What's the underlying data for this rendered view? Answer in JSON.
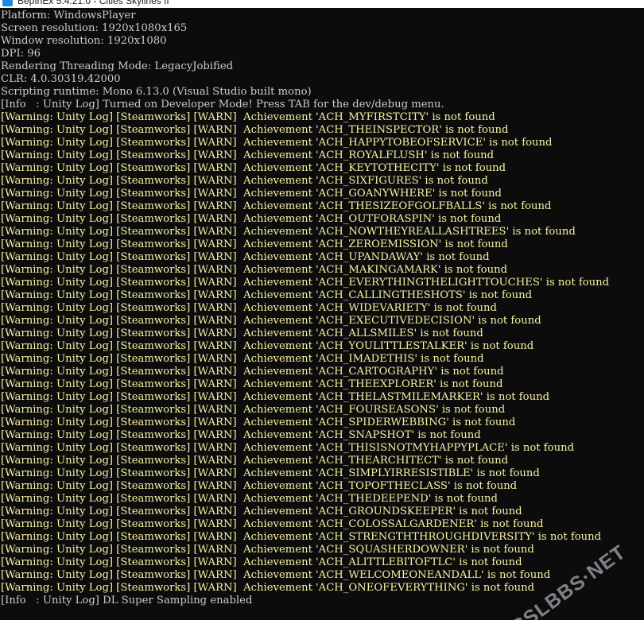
{
  "window": {
    "title": "BepInEx 5.4.21.0 - Cities Skylines II"
  },
  "header_lines": [
    "Platform: WindowsPlayer",
    "Screen resolution: 1920x1080x165",
    "Window resolution: 1920x1080",
    "DPI: 96",
    "Rendering Threading Mode: LegacyJobified",
    "CLR: 4.0.30319.42000",
    "Scripting runtime: Mono 6.13.0 (Visual Studio built mono)"
  ],
  "info_dev_mode": "[Info   : Unity Log] Turned on Developer Mode! Press TAB for the dev/debug menu.",
  "warning_lines": [
    "[Warning: Unity Log] [Steamworks] [WARN]  Achievement 'ACH_MYFIRSTCITY' is not found",
    "[Warning: Unity Log] [Steamworks] [WARN]  Achievement 'ACH_THEINSPECTOR' is not found",
    "[Warning: Unity Log] [Steamworks] [WARN]  Achievement 'ACH_HAPPYTOBEOFSERVICE' is not found",
    "[Warning: Unity Log] [Steamworks] [WARN]  Achievement 'ACH_ROYALFLUSH' is not found",
    "[Warning: Unity Log] [Steamworks] [WARN]  Achievement 'ACH_KEYTOTHECITY' is not found",
    "[Warning: Unity Log] [Steamworks] [WARN]  Achievement 'ACH_SIXFIGURES' is not found",
    "[Warning: Unity Log] [Steamworks] [WARN]  Achievement 'ACH_GOANYWHERE' is not found",
    "[Warning: Unity Log] [Steamworks] [WARN]  Achievement 'ACH_THESIZEOFGOLFBALLS' is not found",
    "[Warning: Unity Log] [Steamworks] [WARN]  Achievement 'ACH_OUTFORASPIN' is not found",
    "[Warning: Unity Log] [Steamworks] [WARN]  Achievement 'ACH_NOWTHEYREALLASHTREES' is not found",
    "[Warning: Unity Log] [Steamworks] [WARN]  Achievement 'ACH_ZEROEMISSION' is not found",
    "[Warning: Unity Log] [Steamworks] [WARN]  Achievement 'ACH_UPANDAWAY' is not found",
    "[Warning: Unity Log] [Steamworks] [WARN]  Achievement 'ACH_MAKINGAMARK' is not found",
    "[Warning: Unity Log] [Steamworks] [WARN]  Achievement 'ACH_EVERYTHINGTHELIGHTTOUCHES' is not found",
    "[Warning: Unity Log] [Steamworks] [WARN]  Achievement 'ACH_CALLINGTHESHOTS' is not found",
    "[Warning: Unity Log] [Steamworks] [WARN]  Achievement 'ACH_WIDEVARIETY' is not found",
    "[Warning: Unity Log] [Steamworks] [WARN]  Achievement 'ACH_EXECUTIVEDECISION' is not found",
    "[Warning: Unity Log] [Steamworks] [WARN]  Achievement 'ACH_ALLSMILES' is not found",
    "[Warning: Unity Log] [Steamworks] [WARN]  Achievement 'ACH_YOULITTLESTALKER' is not found",
    "[Warning: Unity Log] [Steamworks] [WARN]  Achievement 'ACH_IMADETHIS' is not found",
    "[Warning: Unity Log] [Steamworks] [WARN]  Achievement 'ACH_CARTOGRAPHY' is not found",
    "[Warning: Unity Log] [Steamworks] [WARN]  Achievement 'ACH_THEEXPLORER' is not found",
    "[Warning: Unity Log] [Steamworks] [WARN]  Achievement 'ACH_THELASTMILEMARKER' is not found",
    "[Warning: Unity Log] [Steamworks] [WARN]  Achievement 'ACH_FOURSEASONS' is not found",
    "[Warning: Unity Log] [Steamworks] [WARN]  Achievement 'ACH_SPIDERWEBBING' is not found",
    "[Warning: Unity Log] [Steamworks] [WARN]  Achievement 'ACH_SNAPSHOT' is not found",
    "[Warning: Unity Log] [Steamworks] [WARN]  Achievement 'ACH_THISISNOTMYHAPPYPLACE' is not found",
    "[Warning: Unity Log] [Steamworks] [WARN]  Achievement 'ACH_THEARCHITECT' is not found",
    "[Warning: Unity Log] [Steamworks] [WARN]  Achievement 'ACH_SIMPLYIRRESISTIBLE' is not found",
    "[Warning: Unity Log] [Steamworks] [WARN]  Achievement 'ACH_TOPOFTHECLASS' is not found",
    "[Warning: Unity Log] [Steamworks] [WARN]  Achievement 'ACH_THEDEEPEND' is not found",
    "[Warning: Unity Log] [Steamworks] [WARN]  Achievement 'ACH_GROUNDSKEEPER' is not found",
    "[Warning: Unity Log] [Steamworks] [WARN]  Achievement 'ACH_COLOSSALGARDENER' is not found",
    "[Warning: Unity Log] [Steamworks] [WARN]  Achievement 'ACH_STRENGTHTHROUGHDIVERSITY' is not found",
    "[Warning: Unity Log] [Steamworks] [WARN]  Achievement 'ACH_SQUASHERDOWNER' is not found",
    "[Warning: Unity Log] [Steamworks] [WARN]  Achievement 'ACH_ALITTLEBITOFTLC' is not found",
    "[Warning: Unity Log] [Steamworks] [WARN]  Achievement 'ACH_WELCOMEONEANDALL' is not found",
    "[Warning: Unity Log] [Steamworks] [WARN]  Achievement 'ACH_ONEOFEVERYTHING' is not found"
  ],
  "info_dlss": "[Info   : Unity Log] DL Super Sampling enabled",
  "watermark": "CSLBBS·NET",
  "colors": {
    "background": "#0c0c0c",
    "text": "#cccccc",
    "warning": "#f9f1a5",
    "icon": "#1e88e5"
  }
}
